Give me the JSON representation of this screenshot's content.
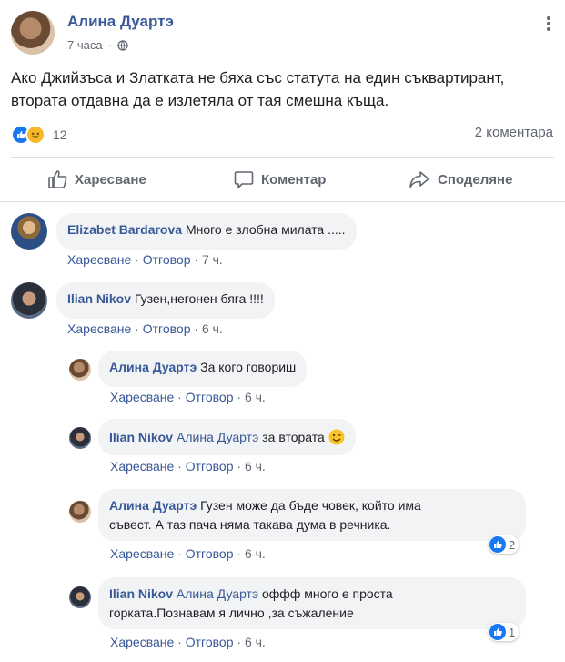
{
  "post": {
    "author": "Алина Дуартэ",
    "time": "7 часа",
    "text_line1": "Ако Джийзъса и Златката не бяха със статута на един съквартирант,",
    "text_line2": "втората отдавна да е излетяла от тая смешна къща.",
    "reaction_count": "12",
    "comment_count": "2 коментара",
    "actions": {
      "like": "Харесване",
      "comment": "Коментар",
      "share": "Споделяне"
    }
  },
  "comments": [
    {
      "name": "Elizabet Bardarova",
      "text": "Много е злобна милата .....",
      "like": "Харесване",
      "reply": "Отговор",
      "time": "7 ч."
    },
    {
      "name": "Ilian Nikov",
      "text": "Гузен,негонен бяга !!!!",
      "like": "Харесване",
      "reply": "Отговор",
      "time": "6 ч."
    }
  ],
  "replies": [
    {
      "name": "Алина Дуартэ",
      "text": "За кого говориш",
      "like": "Харесване",
      "reply": "Отговор",
      "time": "6 ч."
    },
    {
      "name": "Ilian Nikov",
      "mention": "Алина Дуартэ",
      "text": "за втората",
      "like": "Харесване",
      "reply": "Отговор",
      "time": "6 ч."
    },
    {
      "name": "Алина Дуартэ",
      "text_line1": "Гузен може да бъде човек, който има",
      "text_line2": "съвест. А таз пача няма такава дума в речника.",
      "reactions": "2",
      "like": "Харесване",
      "reply": "Отговор",
      "time": "6 ч."
    },
    {
      "name": "Ilian Nikov",
      "mention": "Алина Дуартэ",
      "text_line1": "оффф много е проста",
      "text_line2": "горката.Познавам я лично ,за съжаление",
      "reactions": "1",
      "like": "Харесване",
      "reply": "Отговор",
      "time": "6 ч."
    }
  ]
}
